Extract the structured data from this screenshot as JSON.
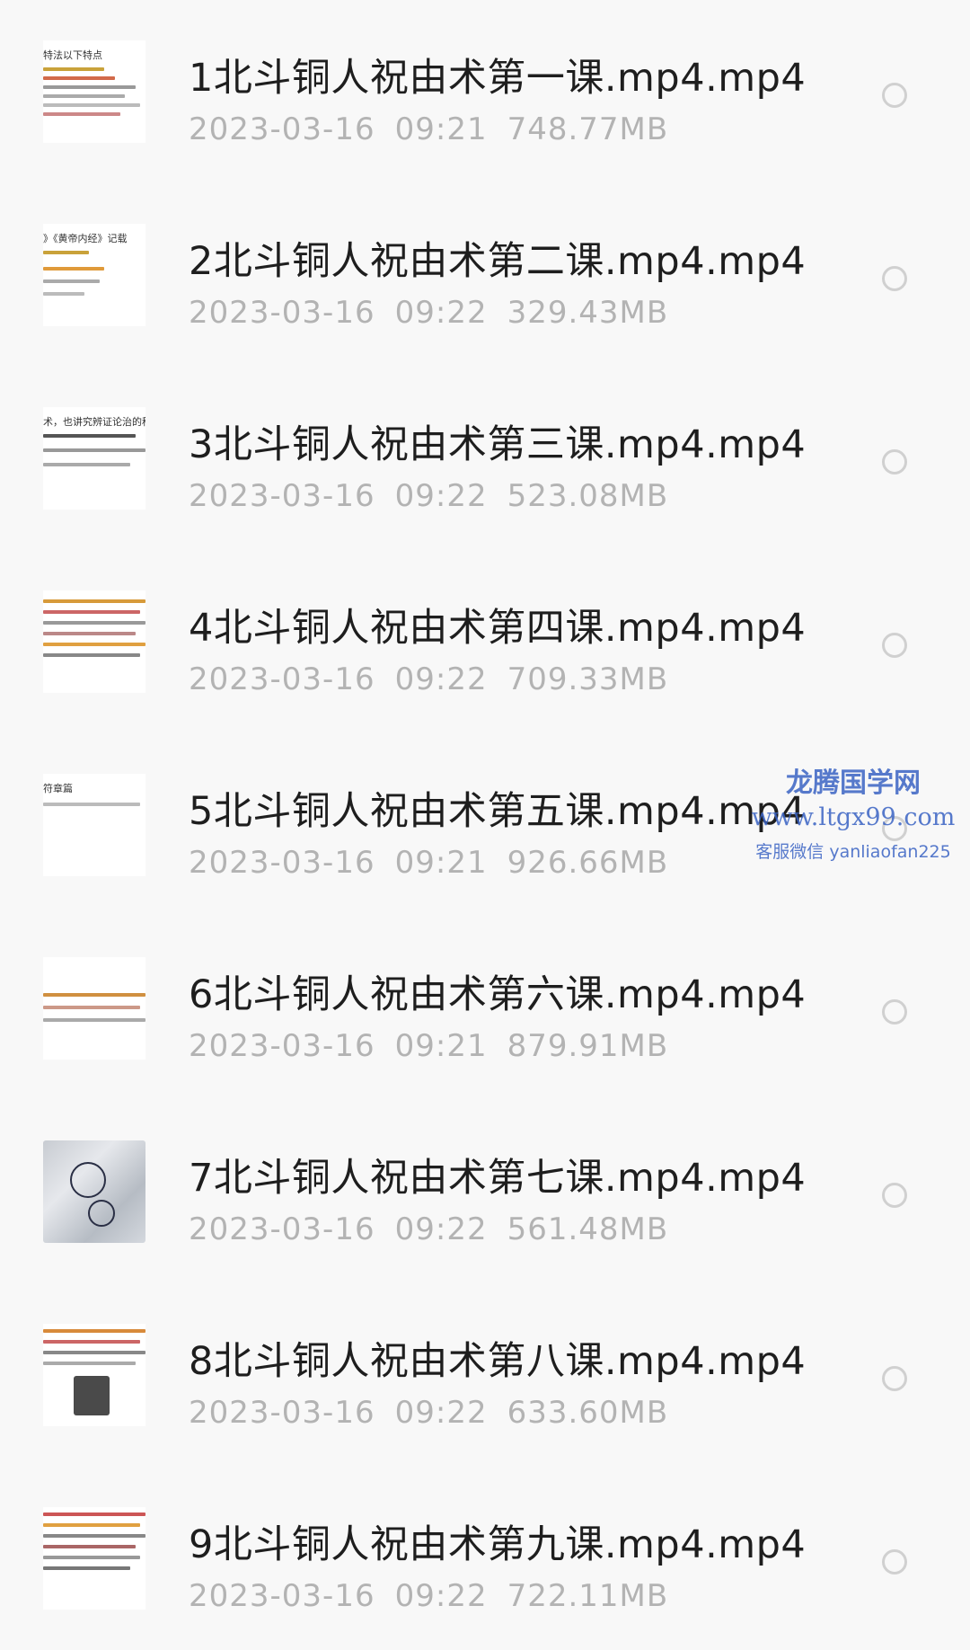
{
  "files": [
    {
      "name": "1北斗铜人祝由术第一课.mp4.mp4",
      "date": "2023-03-16",
      "time": "09:21",
      "size": "748.77MB",
      "thumb_heading": "特法以下特点"
    },
    {
      "name": "2北斗铜人祝由术第二课.mp4.mp4",
      "date": "2023-03-16",
      "time": "09:22",
      "size": "329.43MB",
      "thumb_heading": "》《黄帝内经》记载"
    },
    {
      "name": "3北斗铜人祝由术第三课.mp4.mp4",
      "date": "2023-03-16",
      "time": "09:22",
      "size": "523.08MB",
      "thumb_heading": "术，也讲究辨证论治的科学"
    },
    {
      "name": "4北斗铜人祝由术第四课.mp4.mp4",
      "date": "2023-03-16",
      "time": "09:22",
      "size": "709.33MB",
      "thumb_heading": ""
    },
    {
      "name": "5北斗铜人祝由术第五课.mp4.mp4",
      "date": "2023-03-16",
      "time": "09:21",
      "size": "926.66MB",
      "thumb_heading": "符章篇"
    },
    {
      "name": "6北斗铜人祝由术第六课.mp4.mp4",
      "date": "2023-03-16",
      "time": "09:21",
      "size": "879.91MB",
      "thumb_heading": ""
    },
    {
      "name": "7北斗铜人祝由术第七课.mp4.mp4",
      "date": "2023-03-16",
      "time": "09:22",
      "size": "561.48MB",
      "thumb_heading": ""
    },
    {
      "name": "8北斗铜人祝由术第八课.mp4.mp4",
      "date": "2023-03-16",
      "time": "09:22",
      "size": "633.60MB",
      "thumb_heading": ""
    },
    {
      "name": "9北斗铜人祝由术第九课.mp4.mp4",
      "date": "2023-03-16",
      "time": "09:22",
      "size": "722.11MB",
      "thumb_heading": ""
    }
  ],
  "watermark": {
    "title": "龙腾国学网",
    "url": "www.ltgx99.com",
    "service": "客服微信 yanliaofan225"
  },
  "colors": {
    "title_text": "#1e1e1e",
    "meta_text": "#b3b3b3",
    "radio_border": "#d0d0d0",
    "watermark": "#3a63c4",
    "background": "#f8f8f8"
  },
  "icons": {
    "select": "radio-circle-icon",
    "thumbnail": "video-thumbnail"
  }
}
